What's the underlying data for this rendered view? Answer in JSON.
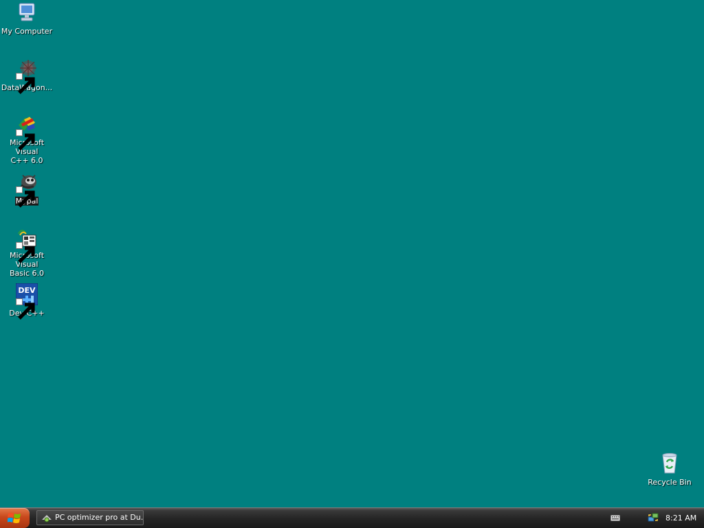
{
  "desktop": {
    "background_color": "#008080",
    "icons": [
      {
        "label": "My Computer",
        "icon": "my-computer-icon"
      },
      {
        "label": "DataWagon...",
        "icon": "datawagon-icon",
        "shortcut": true
      },
      {
        "label": "Microsoft Visual\nC++ 6.0",
        "icon": "visual-cpp-icon",
        "shortcut": true
      },
      {
        "label": "Mypal",
        "icon": "mypal-icon",
        "shortcut": true,
        "selected": true
      },
      {
        "label": "Microsoft Visual\nBasic 6.0",
        "icon": "visual-basic-icon",
        "shortcut": true
      },
      {
        "label": "Dev-C++",
        "icon": "dev-cpp-icon",
        "shortcut": true,
        "icon_text": "DEV"
      },
      {
        "label": "Recycle Bin",
        "icon": "recycle-bin-icon"
      }
    ]
  },
  "taskbar": {
    "start_icon": "windows-logo-icon",
    "tasks": [
      {
        "label": "PC optimizer pro at Du...",
        "icon": "pc-optimizer-icon"
      }
    ],
    "tray": {
      "keyboard_icon": "keyboard-icon",
      "network_icon": "network-icon",
      "clock": "8:21 AM"
    }
  }
}
